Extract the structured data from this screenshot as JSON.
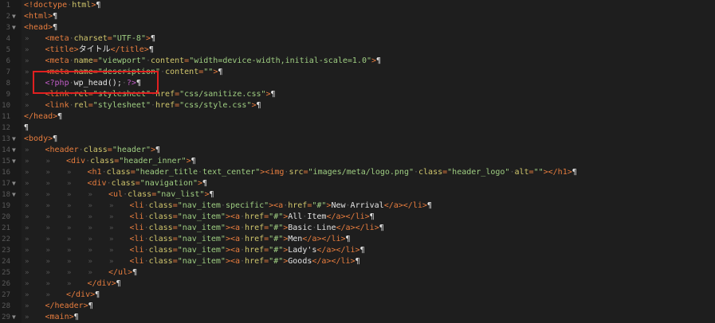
{
  "editor": {
    "indent_glyph": "»",
    "space_dot": "·",
    "pilcrow": "¶",
    "fold_glyph": "▼",
    "lines": [
      {
        "n": "1",
        "fold": false,
        "indent": 0,
        "tokens": [
          [
            "tag",
            "<!doctype"
          ],
          [
            "ws",
            "·"
          ],
          [
            "attr",
            "html"
          ],
          [
            "tag",
            ">"
          ]
        ]
      },
      {
        "n": "2",
        "fold": true,
        "indent": 0,
        "tokens": [
          [
            "tag",
            "<html>"
          ]
        ]
      },
      {
        "n": "3",
        "fold": true,
        "indent": 0,
        "tokens": [
          [
            "tag",
            "<head>"
          ]
        ]
      },
      {
        "n": "4",
        "fold": false,
        "indent": 1,
        "tokens": [
          [
            "tag",
            "<meta"
          ],
          [
            "ws",
            "·"
          ],
          [
            "attr",
            "charset"
          ],
          [
            "tag",
            "="
          ],
          [
            "str",
            "\"UTF-8\""
          ],
          [
            "tag",
            ">"
          ]
        ]
      },
      {
        "n": "5",
        "fold": false,
        "indent": 1,
        "tokens": [
          [
            "tag",
            "<title>"
          ],
          [
            "pl",
            "タイトル"
          ],
          [
            "tag",
            "</title>"
          ]
        ]
      },
      {
        "n": "6",
        "fold": false,
        "indent": 1,
        "tokens": [
          [
            "tag",
            "<meta"
          ],
          [
            "ws",
            "·"
          ],
          [
            "attr",
            "name"
          ],
          [
            "tag",
            "="
          ],
          [
            "str",
            "\"viewport\""
          ],
          [
            "ws",
            "·"
          ],
          [
            "attr",
            "content"
          ],
          [
            "tag",
            "="
          ],
          [
            "str",
            "\"width=device-width,initial-scale=1.0\""
          ],
          [
            "tag",
            ">"
          ]
        ]
      },
      {
        "n": "7",
        "fold": false,
        "indent": 1,
        "tokens": [
          [
            "tag",
            "<meta"
          ],
          [
            "ws",
            "·"
          ],
          [
            "attr",
            "name"
          ],
          [
            "tag",
            "="
          ],
          [
            "str",
            "\"description\""
          ],
          [
            "ws",
            "·"
          ],
          [
            "attr",
            "content"
          ],
          [
            "tag",
            "="
          ],
          [
            "str",
            "\"\""
          ],
          [
            "tag",
            ">"
          ]
        ]
      },
      {
        "n": "8",
        "fold": false,
        "indent": 1,
        "tokens": [
          [
            "php",
            "<?php"
          ],
          [
            "ws",
            "·"
          ],
          [
            "pl",
            "wp_head();"
          ],
          [
            "ws",
            "·"
          ],
          [
            "php",
            "?>"
          ]
        ]
      },
      {
        "n": "9",
        "fold": false,
        "indent": 1,
        "tokens": [
          [
            "tag",
            "<link"
          ],
          [
            "ws",
            "·"
          ],
          [
            "attr",
            "rel"
          ],
          [
            "tag",
            "="
          ],
          [
            "str",
            "\"stylesheet\""
          ],
          [
            "ws",
            "·"
          ],
          [
            "attr",
            "href"
          ],
          [
            "tag",
            "="
          ],
          [
            "str",
            "\"css/sanitize.css\""
          ],
          [
            "tag",
            ">"
          ]
        ]
      },
      {
        "n": "10",
        "fold": false,
        "indent": 1,
        "tokens": [
          [
            "tag",
            "<link"
          ],
          [
            "ws",
            "·"
          ],
          [
            "attr",
            "rel"
          ],
          [
            "tag",
            "="
          ],
          [
            "str",
            "\"stylesheet\""
          ],
          [
            "ws",
            "·"
          ],
          [
            "attr",
            "href"
          ],
          [
            "tag",
            "="
          ],
          [
            "str",
            "\"css/style.css\""
          ],
          [
            "tag",
            ">"
          ]
        ]
      },
      {
        "n": "11",
        "fold": false,
        "indent": 0,
        "tokens": [
          [
            "tag",
            "</head>"
          ]
        ]
      },
      {
        "n": "12",
        "fold": false,
        "indent": 0,
        "tokens": []
      },
      {
        "n": "13",
        "fold": true,
        "indent": 0,
        "tokens": [
          [
            "tag",
            "<body>"
          ]
        ]
      },
      {
        "n": "14",
        "fold": true,
        "indent": 1,
        "tokens": [
          [
            "tag",
            "<header"
          ],
          [
            "ws",
            "·"
          ],
          [
            "attr",
            "class"
          ],
          [
            "tag",
            "="
          ],
          [
            "str",
            "\"header\""
          ],
          [
            "tag",
            ">"
          ]
        ]
      },
      {
        "n": "15",
        "fold": true,
        "indent": 2,
        "tokens": [
          [
            "tag",
            "<div"
          ],
          [
            "ws",
            "·"
          ],
          [
            "attr",
            "class"
          ],
          [
            "tag",
            "="
          ],
          [
            "str",
            "\"header_inner\""
          ],
          [
            "tag",
            ">"
          ]
        ]
      },
      {
        "n": "16",
        "fold": false,
        "indent": 3,
        "tokens": [
          [
            "tag",
            "<h1"
          ],
          [
            "ws",
            "·"
          ],
          [
            "attr",
            "class"
          ],
          [
            "tag",
            "="
          ],
          [
            "str",
            "\"header_title"
          ],
          [
            "ws",
            "·"
          ],
          [
            "str",
            "text_center\""
          ],
          [
            "tag",
            "><img"
          ],
          [
            "ws",
            "·"
          ],
          [
            "attr",
            "src"
          ],
          [
            "tag",
            "="
          ],
          [
            "str",
            "\"images/meta/logo.png\""
          ],
          [
            "ws",
            "·"
          ],
          [
            "attr",
            "class"
          ],
          [
            "tag",
            "="
          ],
          [
            "str",
            "\"header_logo\""
          ],
          [
            "ws",
            "·"
          ],
          [
            "attr",
            "alt"
          ],
          [
            "tag",
            "="
          ],
          [
            "str",
            "\"\""
          ],
          [
            "tag",
            "></h1>"
          ]
        ]
      },
      {
        "n": "17",
        "fold": true,
        "indent": 3,
        "tokens": [
          [
            "tag",
            "<div"
          ],
          [
            "ws",
            "·"
          ],
          [
            "attr",
            "class"
          ],
          [
            "tag",
            "="
          ],
          [
            "str",
            "\"navigation\""
          ],
          [
            "tag",
            ">"
          ]
        ]
      },
      {
        "n": "18",
        "fold": true,
        "indent": 4,
        "tokens": [
          [
            "tag",
            "<ul"
          ],
          [
            "ws",
            "·"
          ],
          [
            "attr",
            "class"
          ],
          [
            "tag",
            "="
          ],
          [
            "str",
            "\"nav_list\""
          ],
          [
            "tag",
            ">"
          ]
        ]
      },
      {
        "n": "19",
        "fold": false,
        "indent": 5,
        "tokens": [
          [
            "tag",
            "<li"
          ],
          [
            "ws",
            "·"
          ],
          [
            "attr",
            "class"
          ],
          [
            "tag",
            "="
          ],
          [
            "str",
            "\"nav_item"
          ],
          [
            "ws",
            "·"
          ],
          [
            "str",
            "specific\""
          ],
          [
            "tag",
            "><a"
          ],
          [
            "ws",
            "·"
          ],
          [
            "attr",
            "href"
          ],
          [
            "tag",
            "="
          ],
          [
            "str",
            "\"#\""
          ],
          [
            "tag",
            ">"
          ],
          [
            "pl",
            "New"
          ],
          [
            "ws",
            "·"
          ],
          [
            "pl",
            "Arrival"
          ],
          [
            "tag",
            "</a></li>"
          ]
        ]
      },
      {
        "n": "20",
        "fold": false,
        "indent": 5,
        "tokens": [
          [
            "tag",
            "<li"
          ],
          [
            "ws",
            "·"
          ],
          [
            "attr",
            "class"
          ],
          [
            "tag",
            "="
          ],
          [
            "str",
            "\"nav_item\""
          ],
          [
            "tag",
            "><a"
          ],
          [
            "ws",
            "·"
          ],
          [
            "attr",
            "href"
          ],
          [
            "tag",
            "="
          ],
          [
            "str",
            "\"#\""
          ],
          [
            "tag",
            ">"
          ],
          [
            "pl",
            "All"
          ],
          [
            "ws",
            "·"
          ],
          [
            "pl",
            "Item"
          ],
          [
            "tag",
            "</a></li>"
          ]
        ]
      },
      {
        "n": "21",
        "fold": false,
        "indent": 5,
        "tokens": [
          [
            "tag",
            "<li"
          ],
          [
            "ws",
            "·"
          ],
          [
            "attr",
            "class"
          ],
          [
            "tag",
            "="
          ],
          [
            "str",
            "\"nav_item\""
          ],
          [
            "tag",
            "><a"
          ],
          [
            "ws",
            "·"
          ],
          [
            "attr",
            "href"
          ],
          [
            "tag",
            "="
          ],
          [
            "str",
            "\"#\""
          ],
          [
            "tag",
            ">"
          ],
          [
            "pl",
            "Basic"
          ],
          [
            "ws",
            "·"
          ],
          [
            "pl",
            "Line"
          ],
          [
            "tag",
            "</a></li>"
          ]
        ]
      },
      {
        "n": "22",
        "fold": false,
        "indent": 5,
        "tokens": [
          [
            "tag",
            "<li"
          ],
          [
            "ws",
            "·"
          ],
          [
            "attr",
            "class"
          ],
          [
            "tag",
            "="
          ],
          [
            "str",
            "\"nav_item\""
          ],
          [
            "tag",
            "><a"
          ],
          [
            "ws",
            "·"
          ],
          [
            "attr",
            "href"
          ],
          [
            "tag",
            "="
          ],
          [
            "str",
            "\"#\""
          ],
          [
            "tag",
            ">"
          ],
          [
            "pl",
            "Men"
          ],
          [
            "tag",
            "</a></li>"
          ]
        ]
      },
      {
        "n": "23",
        "fold": false,
        "indent": 5,
        "tokens": [
          [
            "tag",
            "<li"
          ],
          [
            "ws",
            "·"
          ],
          [
            "attr",
            "class"
          ],
          [
            "tag",
            "="
          ],
          [
            "str",
            "\"nav_item\""
          ],
          [
            "tag",
            "><a"
          ],
          [
            "ws",
            "·"
          ],
          [
            "attr",
            "href"
          ],
          [
            "tag",
            "="
          ],
          [
            "str",
            "\"#\""
          ],
          [
            "tag",
            ">"
          ],
          [
            "pl",
            "Lady's"
          ],
          [
            "tag",
            "</a></li>"
          ]
        ]
      },
      {
        "n": "24",
        "fold": false,
        "indent": 5,
        "tokens": [
          [
            "tag",
            "<li"
          ],
          [
            "ws",
            "·"
          ],
          [
            "attr",
            "class"
          ],
          [
            "tag",
            "="
          ],
          [
            "str",
            "\"nav_item\""
          ],
          [
            "tag",
            "><a"
          ],
          [
            "ws",
            "·"
          ],
          [
            "attr",
            "href"
          ],
          [
            "tag",
            "="
          ],
          [
            "str",
            "\"#\""
          ],
          [
            "tag",
            ">"
          ],
          [
            "pl",
            "Goods"
          ],
          [
            "tag",
            "</a></li>"
          ]
        ]
      },
      {
        "n": "25",
        "fold": false,
        "indent": 4,
        "tokens": [
          [
            "tag",
            "</ul>"
          ]
        ]
      },
      {
        "n": "26",
        "fold": false,
        "indent": 3,
        "tokens": [
          [
            "tag",
            "</div>"
          ]
        ]
      },
      {
        "n": "27",
        "fold": false,
        "indent": 2,
        "tokens": [
          [
            "tag",
            "</div>"
          ]
        ]
      },
      {
        "n": "28",
        "fold": false,
        "indent": 1,
        "tokens": [
          [
            "tag",
            "</header>"
          ]
        ]
      },
      {
        "n": "29",
        "fold": true,
        "indent": 1,
        "tokens": [
          [
            "tag",
            "<main>"
          ]
        ]
      }
    ]
  }
}
